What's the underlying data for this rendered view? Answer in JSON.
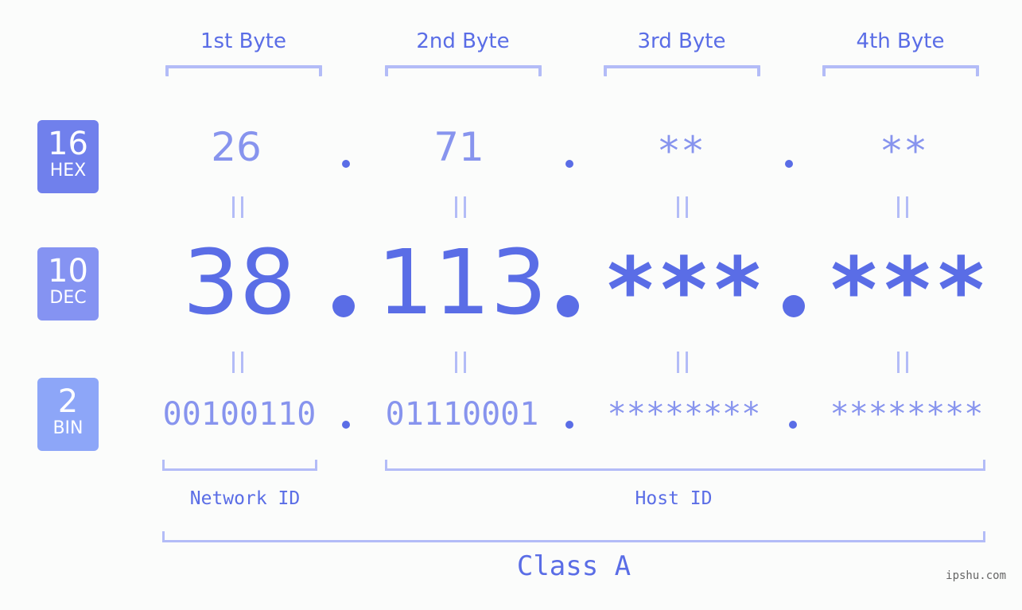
{
  "byte_headers": [
    "1st Byte",
    "2nd Byte",
    "3rd Byte",
    "4th Byte"
  ],
  "badges": [
    {
      "num": "16",
      "label": "HEX",
      "color": "#7080ec"
    },
    {
      "num": "10",
      "label": "DEC",
      "color": "#8593f2"
    },
    {
      "num": "2",
      "label": "BIN",
      "color": "#8da6f8"
    }
  ],
  "hex": [
    "26",
    "71",
    "**",
    "**"
  ],
  "dec": [
    "38",
    "113",
    "***",
    "***"
  ],
  "bin": [
    "00100110",
    "01110001",
    "********",
    "********"
  ],
  "separator": ".",
  "network_label": "Network ID",
  "host_label": "Host ID",
  "class_label": "Class A",
  "watermark": "ipshu.com",
  "colors": {
    "accent": "#5a6de6",
    "light": "#8794ee",
    "bracket": "#b3bcf7",
    "background": "#fbfcfb"
  }
}
